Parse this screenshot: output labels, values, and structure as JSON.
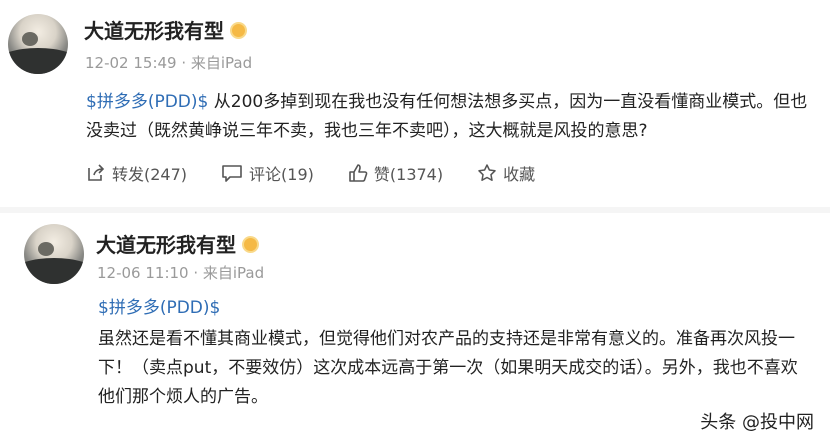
{
  "posts": [
    {
      "author": "大道无形我有型",
      "meta": "12-02 15:49 · 来自iPad",
      "stock_tag": "$拼多多(PDD)$",
      "content": " 从200多掉到现在我也没有任何想法想多买点，因为一直没看懂商业模式。但也没卖过（既然黄峥说三年不卖，我也三年不卖吧），这大概就是风投的意思?",
      "actions": {
        "repost": "转发(247)",
        "comment": "评论(19)",
        "like": "赞(1374)",
        "favorite": "收藏"
      }
    },
    {
      "author": "大道无形我有型",
      "meta": "12-06 11:10 · 来自iPad",
      "stock_tag": "$拼多多(PDD)$",
      "content": "虽然还是看不懂其商业模式，但觉得他们对农产品的支持还是非常有意义的。准备再次风投一下！（卖点put，不要效仿）这次成本远高于第一次（如果明天成交的话）。另外，我也不喜欢他们那个烦人的广告。"
    }
  ],
  "watermark": "头条 @投中网",
  "colors": {
    "link": "#2f6db5",
    "meta": "#9a9a9a",
    "badge": "#f5b945"
  }
}
